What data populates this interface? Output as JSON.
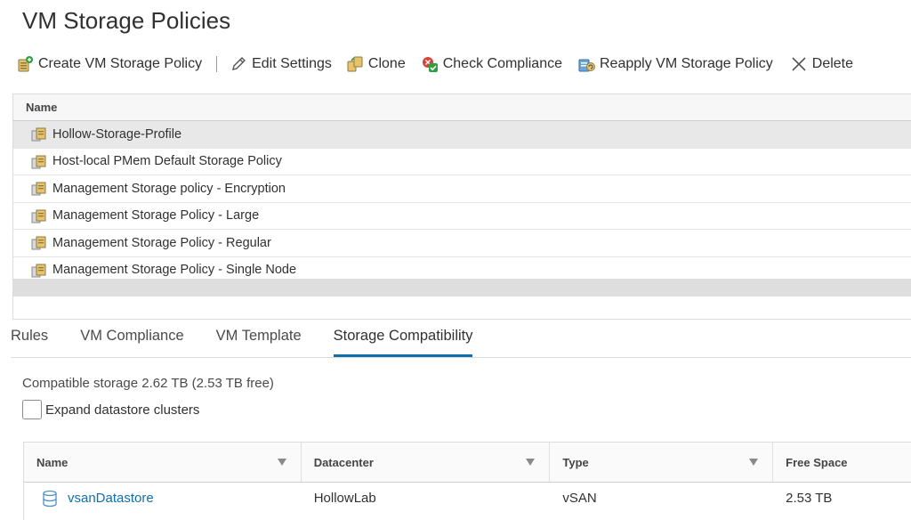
{
  "page": {
    "title": "VM Storage Policies"
  },
  "toolbar": {
    "create": "Create VM Storage Policy",
    "edit": "Edit Settings",
    "clone": "Clone",
    "check": "Check Compliance",
    "reapply": "Reapply VM Storage Policy",
    "delete": "Delete"
  },
  "policies": {
    "header": "Name",
    "rows": [
      "Hollow-Storage-Profile",
      "Host-local PMem Default Storage Policy",
      "Management Storage policy - Encryption",
      "Management Storage Policy - Large",
      "Management Storage Policy - Regular",
      "Management Storage Policy - Single Node"
    ],
    "selected_index": 0
  },
  "tabs": [
    "Rules",
    "VM Compliance",
    "VM Template",
    "Storage Compatibility"
  ],
  "active_tab": "Storage Compatibility",
  "compat": {
    "summary": "Compatible storage 2.62 TB (2.53 TB free)",
    "expand_label": "Expand datastore clusters",
    "expand_checked": false
  },
  "datastores": {
    "headers": [
      "Name",
      "Datacenter",
      "Type",
      "Free Space"
    ],
    "rows": [
      {
        "name": "vsanDatastore",
        "datacenter": "HollowLab",
        "type": "vSAN",
        "free": "2.53 TB"
      }
    ]
  },
  "icons": {
    "create": "create-policy-icon",
    "edit": "pencil-icon",
    "clone": "clone-icon",
    "check": "check-compliance-icon",
    "reapply": "reapply-icon",
    "delete": "close-icon",
    "policy": "storage-policy-icon",
    "datastore": "datastore-icon",
    "filter": "filter-icon"
  },
  "colors": {
    "link": "#0f6fad",
    "tab_underline": "#0f6fad",
    "selected_row": "#e8e8e8"
  }
}
